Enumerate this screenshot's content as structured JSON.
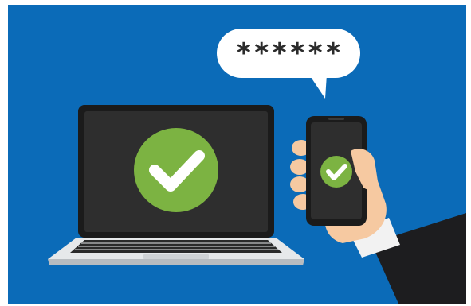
{
  "speech_bubble": {
    "text": "******"
  },
  "colors": {
    "background": "#0b6bb8",
    "screen": "#2e2e2e",
    "check_green": "#7cb342",
    "laptop_silver": "#e6e8ea",
    "skin": "#f6c9a1",
    "suit": "#1d1d1f"
  },
  "icons": [
    "check-icon",
    "laptop-icon",
    "smartphone-icon",
    "speech-bubble-icon",
    "hand-icon"
  ]
}
